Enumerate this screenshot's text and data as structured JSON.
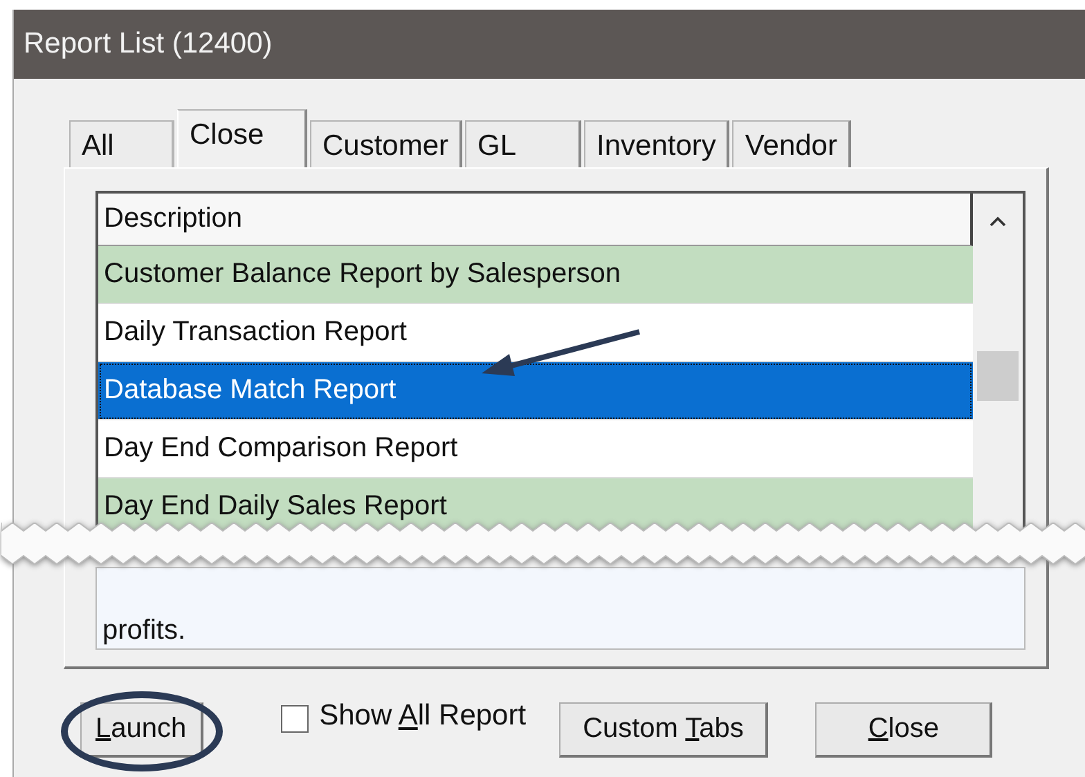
{
  "window": {
    "title": "Report List (12400)"
  },
  "tabs": [
    {
      "label": "All",
      "selected": false
    },
    {
      "label": "Close",
      "selected": true
    },
    {
      "label": "Customer",
      "selected": false
    },
    {
      "label": "GL",
      "selected": false
    },
    {
      "label": "Inventory",
      "selected": false
    },
    {
      "label": "Vendor",
      "selected": false
    }
  ],
  "table": {
    "columns": [
      "Description"
    ],
    "rows": [
      {
        "description": "Customer Balance Report by Salesperson",
        "highlighted": true,
        "selected": false
      },
      {
        "description": "Daily Transaction Report",
        "highlighted": false,
        "selected": false
      },
      {
        "description": "Database Match Report",
        "highlighted": false,
        "selected": true
      },
      {
        "description": "Day End Comparison Report",
        "highlighted": false,
        "selected": false
      },
      {
        "description": "Day End Daily Sales Report",
        "highlighted": true,
        "selected": false
      }
    ]
  },
  "description_text": "profits.",
  "show_all": {
    "before": "Show ",
    "key": "A",
    "after": "ll Report",
    "checked": false
  },
  "buttons": [
    {
      "key": "L",
      "after": "aunch",
      "circled": true
    },
    {
      "before": "Custom ",
      "key": "T",
      "after": "abs",
      "circled": false
    },
    {
      "key": "C",
      "after": "lose",
      "circled": false
    }
  ]
}
